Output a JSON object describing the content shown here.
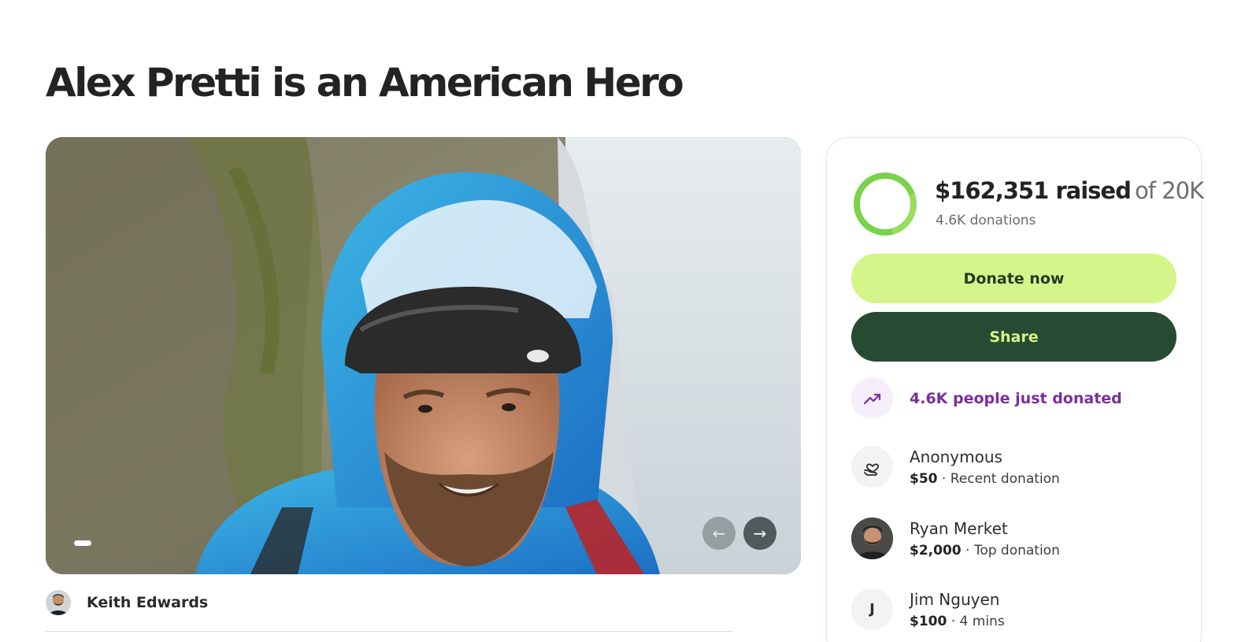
{
  "campaign": {
    "title": "Alex Pretti is an American Hero"
  },
  "carousel": {
    "prev_icon": "arrow-left-icon",
    "next_icon": "arrow-right-icon",
    "prev_glyph": "←",
    "next_glyph": "→"
  },
  "organizer": {
    "name": "Keith Edwards"
  },
  "donate_card": {
    "amount_raised": "$162,351 raised",
    "goal_text": "of 20K",
    "donations_count": "4.6K donations",
    "progress_fraction": 1.0,
    "donate_label": "Donate now",
    "share_label": "Share",
    "trend_text": "4.6K people just donated",
    "trend_icon": "trending-up-icon"
  },
  "donors": [
    {
      "name": "Anonymous",
      "amount": "$50",
      "detail": " · Recent donation",
      "icon": "heart-hand-icon"
    },
    {
      "name": "Ryan Merket",
      "amount": "$2,000",
      "detail": " · Top donation",
      "icon": "avatar"
    },
    {
      "name": "Jim Nguyen",
      "amount": "$100",
      "detail": " · 4 mins",
      "initial": "J"
    }
  ],
  "colors": {
    "accent_green": "#d4f58a",
    "dark_green": "#274a32",
    "trend_purple": "#7a2e9e",
    "progress_green": "#7bd24a"
  }
}
